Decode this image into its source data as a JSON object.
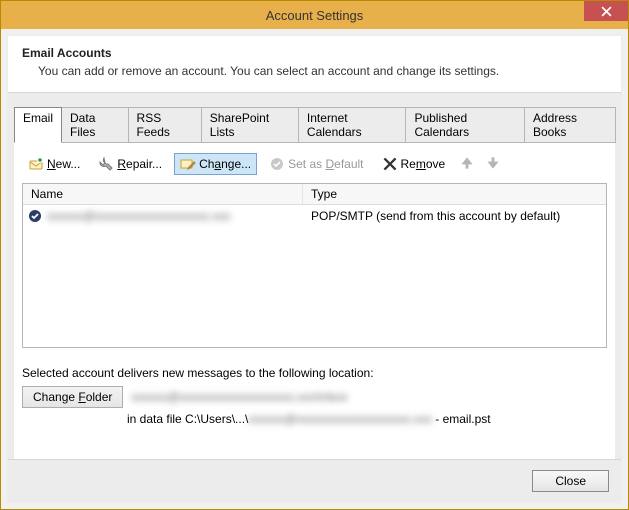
{
  "window": {
    "title": "Account Settings"
  },
  "header": {
    "heading": "Email Accounts",
    "sub": "You can add or remove an account. You can select an account and change its settings."
  },
  "tabs": [
    {
      "label": "Email",
      "active": true
    },
    {
      "label": "Data Files"
    },
    {
      "label": "RSS Feeds"
    },
    {
      "label": "SharePoint Lists"
    },
    {
      "label": "Internet Calendars"
    },
    {
      "label": "Published Calendars"
    },
    {
      "label": "Address Books"
    }
  ],
  "toolbar": {
    "new": "New...",
    "repair": "Repair...",
    "change": "Change...",
    "set_default": "Set as Default",
    "remove": "Remove"
  },
  "list": {
    "col_name": "Name",
    "col_type": "Type",
    "rows": [
      {
        "name": "xxxxxx@xxxxxxxxxxxxxxxxxxx.xxx",
        "type": "POP/SMTP (send from this account by default)"
      }
    ]
  },
  "delivery": {
    "heading": "Selected account delivers new messages to the following location:",
    "change_folder": "Change Folder",
    "loc_blurred": "xxxxxx@xxxxxxxxxxxxxxxxxxx.xxx\\Inbox",
    "path_prefix": "in data file C:\\Users\\...\\",
    "path_blurred": "xxxxxx@xxxxxxxxxxxxxxxxxxx.xxx",
    "path_suffix": " - email.pst"
  },
  "footer": {
    "close": "Close"
  }
}
